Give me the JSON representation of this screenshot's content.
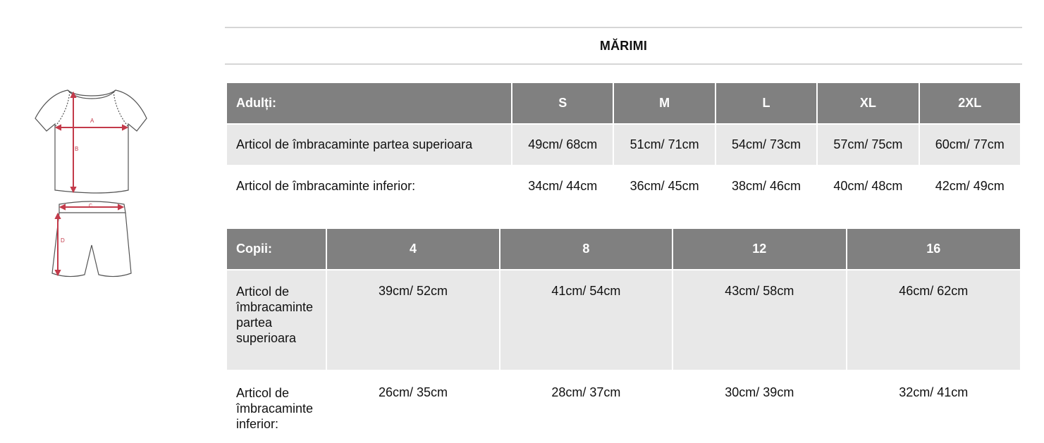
{
  "heading": "MĂRIMI",
  "illustration": {
    "top_labels": [
      "A",
      "B"
    ],
    "bottom_labels": [
      "C",
      "D"
    ]
  },
  "adults": {
    "label": "Adulți:",
    "sizes": [
      "S",
      "M",
      "L",
      "XL",
      "2XL"
    ],
    "rows": [
      {
        "label": "Articol de îmbracaminte partea superioara",
        "values": [
          "49cm/ 68cm",
          "51cm/ 71cm",
          "54cm/ 73cm",
          "57cm/ 75cm",
          "60cm/ 77cm"
        ]
      },
      {
        "label": "Articol de îmbracaminte inferior:",
        "values": [
          "34cm/ 44cm",
          "36cm/ 45cm",
          "38cm/ 46cm",
          "40cm/ 48cm",
          "42cm/ 49cm"
        ]
      }
    ]
  },
  "kids": {
    "label": "Copii:",
    "sizes": [
      "4",
      "8",
      "12",
      "16"
    ],
    "rows": [
      {
        "label": "Articol de îmbracaminte partea superioara",
        "values": [
          "39cm/ 52cm",
          "41cm/ 54cm",
          "43cm/ 58cm",
          "46cm/ 62cm"
        ]
      },
      {
        "label": "Articol de îmbracaminte inferior:",
        "values": [
          "26cm/ 35cm",
          "28cm/ 37cm",
          "30cm/ 39cm",
          "32cm/ 41cm"
        ]
      }
    ]
  }
}
